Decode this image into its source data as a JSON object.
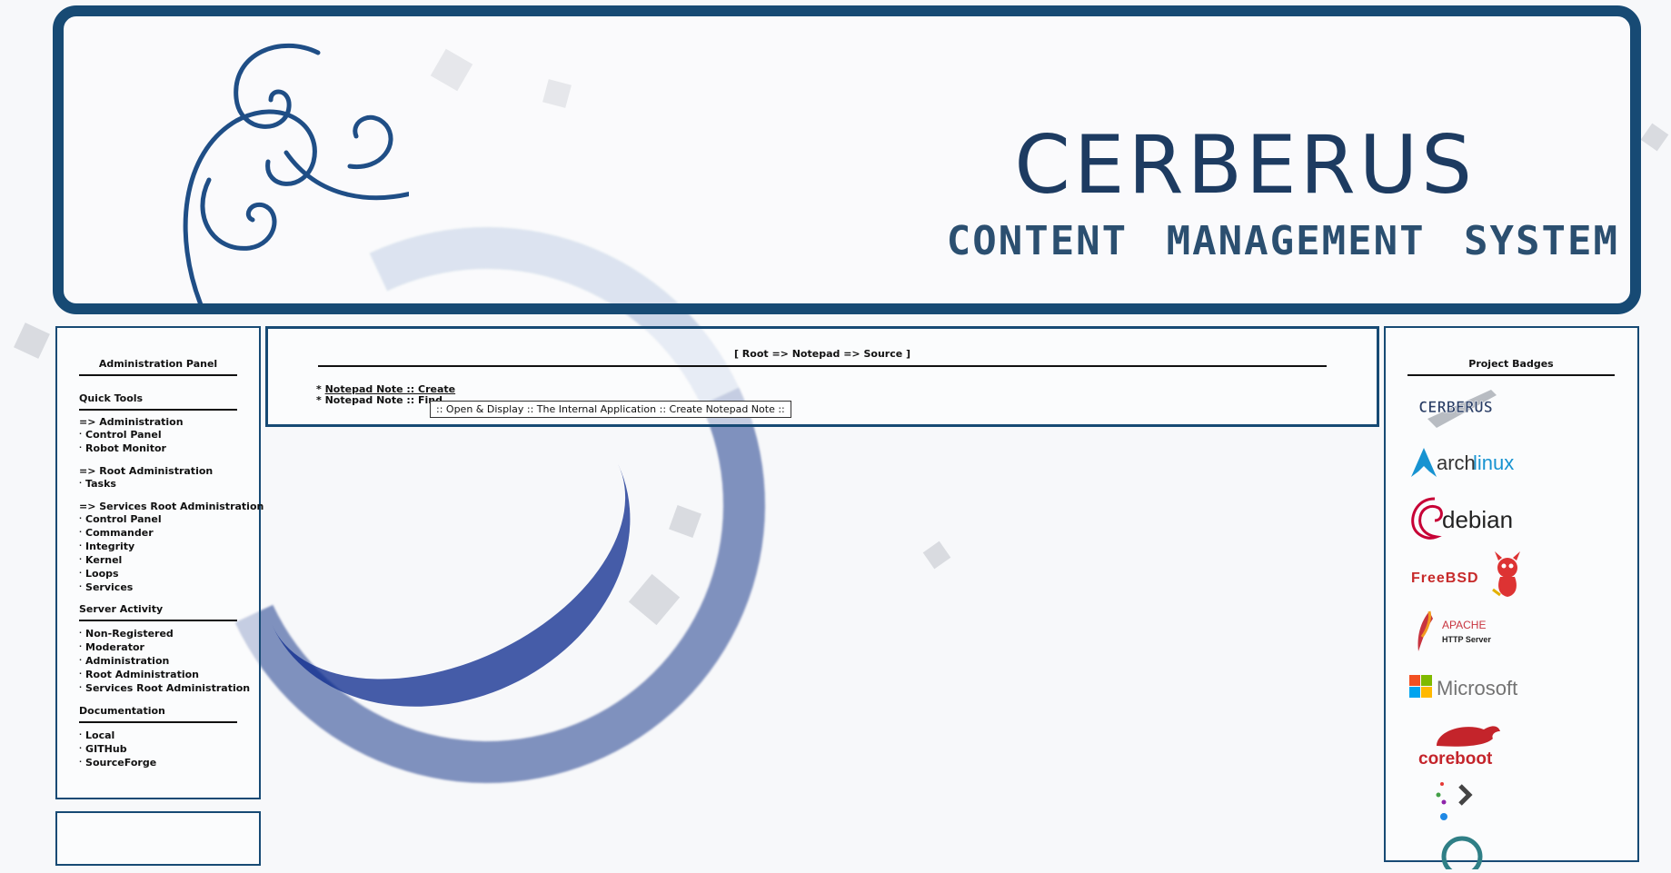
{
  "banner": {
    "title": "CERBERUS",
    "subtitle": "CONTENT MANAGEMENT SYSTEM"
  },
  "left_panel": {
    "heading": "Administration Panel",
    "quick_tools": {
      "heading": "Quick Tools",
      "groups": [
        {
          "title": "=> Administration",
          "items": [
            "Control Panel",
            "Robot Monitor"
          ]
        },
        {
          "title": "=> Root Administration",
          "items": [
            "Tasks"
          ]
        },
        {
          "title": "=> Services Root Administration",
          "items": [
            "Control Panel",
            "Commander",
            "Integrity",
            "Kernel",
            "Loops",
            "Services"
          ]
        }
      ]
    },
    "server_activity": {
      "heading": "Server Activity",
      "items": [
        "Non-Registered",
        "Moderator",
        "Administration",
        "Root Administration",
        "Services Root Administration"
      ]
    },
    "documentation": {
      "heading": "Documentation",
      "items": [
        "Local",
        "GITHub",
        "SourceForge"
      ]
    }
  },
  "main": {
    "breadcrumb": "[ Root => Notepad => Source ]",
    "links": [
      {
        "prefix": "* ",
        "label": "Notepad Note :: Create"
      },
      {
        "prefix": "* ",
        "label": "Notepad Note :: Find"
      }
    ],
    "tooltip": ":: Open & Display :: The Internal Application :: Create Notepad Note ::"
  },
  "right_panel": {
    "heading": "Project Badges",
    "badges": [
      {
        "name": "cerberus",
        "text": "CERBERUS"
      },
      {
        "name": "archlinux",
        "text_a": "arch",
        "text_b": "linux"
      },
      {
        "name": "debian",
        "text": "debian"
      },
      {
        "name": "freebsd",
        "text": "FreeBSD"
      },
      {
        "name": "apache",
        "text_a": "APACHE",
        "text_b": "HTTP Server"
      },
      {
        "name": "microsoft",
        "text": "Microsoft"
      },
      {
        "name": "coreboot",
        "text": "coreboot"
      }
    ]
  },
  "colors": {
    "frame": "#174a74",
    "title": "#1d3b61",
    "arch_blue": "#1793d1",
    "debian_red": "#c70036",
    "freebsd_red": "#c72a2a",
    "coreboot_red": "#c4242b"
  }
}
